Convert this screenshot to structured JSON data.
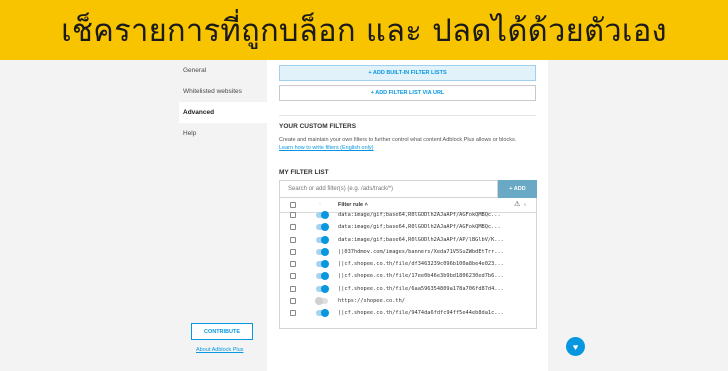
{
  "banner": {
    "title": "เช็ครายการที่ถูกบล็อก และ ปลดได้ด้วยตัวเอง"
  },
  "sidebar": {
    "items": [
      {
        "label": "General"
      },
      {
        "label": "Whitelisted websites"
      },
      {
        "label": "Advanced"
      },
      {
        "label": "Help"
      }
    ],
    "active": "Advanced",
    "contribute_label": "CONTRIBUTE",
    "about_label": "About Adblock Plus"
  },
  "filter_lists": {
    "add_builtin_label": "+ ADD BUILT-IN FILTER LISTS",
    "add_url_label": "+ ADD FILTER LIST VIA URL"
  },
  "custom_filters": {
    "title": "YOUR CUSTOM FILTERS",
    "description": "Create and maintain your own filters to further control what content Adblock Plus allows or blocks.",
    "learn_link": "Learn how to write filters (English only)"
  },
  "my_filter_list": {
    "title": "MY FILTER LIST",
    "search_placeholder": "Search or add filter(s) (e.g. /ads/track/*)",
    "add_label": "+ ADD",
    "columns": {
      "status": "·",
      "rule": "Filter rule ˄",
      "warning": "⚠",
      "warning_sort": "˅"
    },
    "rows": [
      {
        "rule": "data:image/gif;base64,R0lGODlh2AJaAPf/AGFokQMBQc...",
        "enabled": true
      },
      {
        "rule": "data:image/gif;base64,R0lGODlh2AJaAPf/AGFokQMBQc...",
        "enabled": true
      },
      {
        "rule": "data:image/gif;base64,R0lGODlh2AJaAPf/AP/lBGlbV/K...",
        "enabled": true
      },
      {
        "rule": "||037hdmov.com/images/banners/Xeda71V5SuZWbdEtTrr...",
        "enabled": true
      },
      {
        "rule": "||cf.shopee.co.th/file/df3463239c096b100a8be4e023...",
        "enabled": true
      },
      {
        "rule": "||cf.shopee.co.th/file/17ee0b46e3b9bd1806230ed7b6...",
        "enabled": true
      },
      {
        "rule": "||cf.shopee.co.th/file/6aa596354809a178a706fd87d4...",
        "enabled": true
      },
      {
        "rule": "https://shopee.co.th/",
        "enabled": false
      },
      {
        "rule": "||cf.shopee.co.th/file/9474da6fdfc94ff5e44eb8da1c...",
        "enabled": true
      }
    ]
  },
  "colors": {
    "accent": "#0797e1",
    "banner": "#f8c400"
  },
  "icons": {
    "support": "heart-icon"
  }
}
